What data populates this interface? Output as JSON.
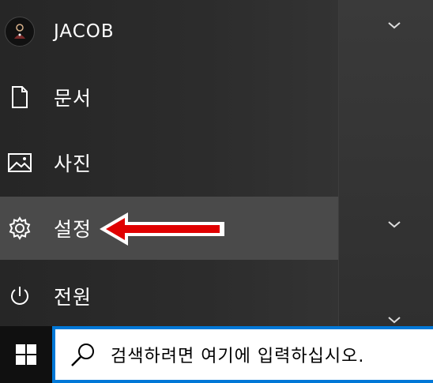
{
  "menu": {
    "user": {
      "name": "JACOB",
      "icon": "user-avatar"
    },
    "items": [
      {
        "label": "문서",
        "icon": "document-icon"
      },
      {
        "label": "사진",
        "icon": "picture-icon"
      },
      {
        "label": "설정",
        "icon": "gear-icon"
      },
      {
        "label": "전원",
        "icon": "power-icon"
      }
    ]
  },
  "annotation": {
    "color": "#e00000",
    "icon": "red-arrow-left"
  },
  "taskbar": {
    "start_icon": "windows-logo-icon",
    "search": {
      "placeholder": "검색하려면 여기에 입력하십시오.",
      "icon": "search-icon"
    },
    "accent": "#0078d7"
  }
}
